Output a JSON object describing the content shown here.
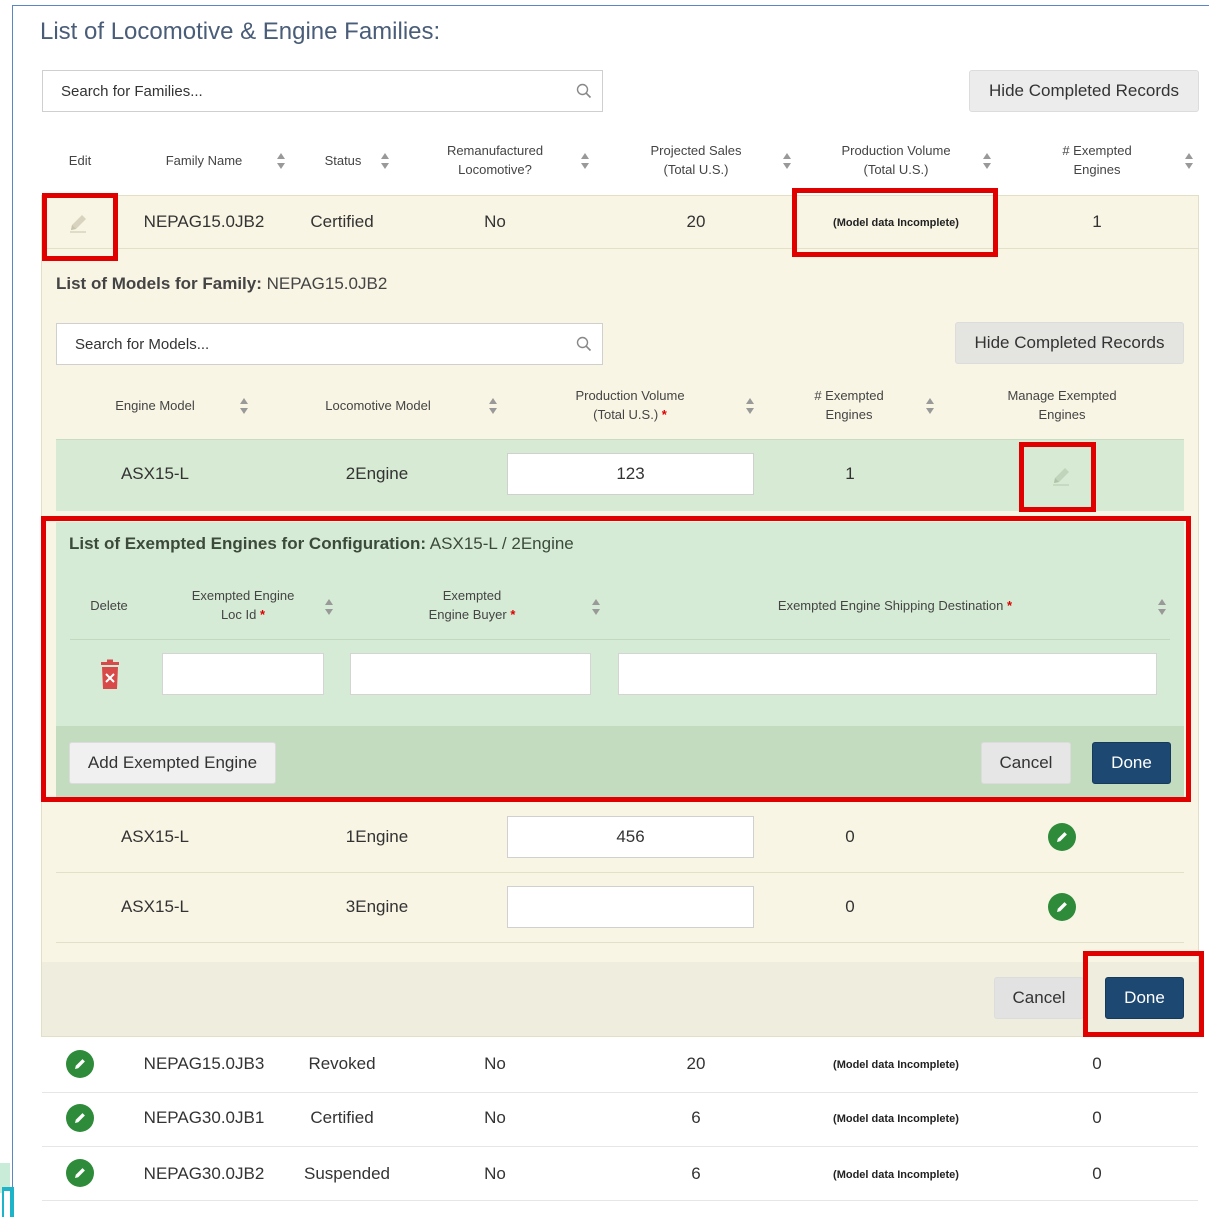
{
  "page": {
    "title": "List of Locomotive & Engine Families:"
  },
  "family_search": {
    "placeholder": "Search for Families..."
  },
  "family_hide_button": "Hide Completed Records",
  "family_table": {
    "headers": {
      "edit": "Edit",
      "family_name": "Family Name",
      "status": "Status",
      "reman_1": "Remanufactured",
      "reman_2": "Locomotive?",
      "sales_1": "Projected Sales",
      "sales_2": "(Total U.S.)",
      "prod_1": "Production Volume",
      "prod_2": "(Total U.S.)",
      "exempt_1": "# Exempted",
      "exempt_2": "Engines"
    },
    "expanded_row": {
      "family_name": "NEPAG15.0JB2",
      "status": "Certified",
      "remanufactured": "No",
      "projected_sales": "20",
      "production_volume": "(Model data Incomplete)",
      "exempted": "1"
    },
    "other_rows": [
      {
        "family_name": "NEPAG15.0JB3",
        "status": "Revoked",
        "remanufactured": "No",
        "projected_sales": "20",
        "production_volume": "(Model data Incomplete)",
        "exempted": "0"
      },
      {
        "family_name": "NEPAG30.0JB1",
        "status": "Certified",
        "remanufactured": "No",
        "projected_sales": "6",
        "production_volume": "(Model data Incomplete)",
        "exempted": "0"
      },
      {
        "family_name": "NEPAG30.0JB2",
        "status": "Suspended",
        "remanufactured": "No",
        "projected_sales": "6",
        "production_volume": "(Model data Incomplete)",
        "exempted": "0"
      }
    ]
  },
  "models": {
    "title_label": "List of Models for Family:",
    "title_value": "NEPAG15.0JB2",
    "search_placeholder": "Search for Models...",
    "hide_button": "Hide Completed Records",
    "headers": {
      "engine_model": "Engine Model",
      "loco_model": "Locomotive Model",
      "prod_1": "Production Volume",
      "prod_2": "(Total U.S.)",
      "exempt_1": "# Exempted",
      "exempt_2": "Engines",
      "manage_1": "Manage Exempted",
      "manage_2": "Engines"
    },
    "rows": [
      {
        "engine_model": "ASX15-L",
        "loco_model": "2Engine",
        "production": "123",
        "exempted": "1"
      },
      {
        "engine_model": "ASX15-L",
        "loco_model": "1Engine",
        "production": "456",
        "exempted": "0"
      },
      {
        "engine_model": "ASX15-L",
        "loco_model": "3Engine",
        "production": "",
        "exempted": "0"
      }
    ],
    "cancel_button": "Cancel",
    "done_button": "Done"
  },
  "exempted": {
    "title_label": "List of Exempted Engines for Configuration:",
    "title_value": "ASX15-L / 2Engine",
    "headers": {
      "delete": "Delete",
      "loc_1": "Exempted Engine",
      "loc_2": "Loc Id",
      "buyer_1": "Exempted",
      "buyer_2": "Engine Buyer",
      "dest": "Exempted Engine Shipping Destination",
      "required": "*"
    },
    "add_button": "Add Exempted Engine",
    "cancel_button": "Cancel",
    "done_button": "Done"
  },
  "colors": {
    "title": "#4a5d78",
    "highlight": "#e00000",
    "primary_button": "#1d4872",
    "family_panel": "#f8f5e4",
    "config_panel": "#d6ebd5",
    "edit_icon_green": "#2e8b3a"
  },
  "icons": {
    "search": "search-icon",
    "sort": "sort-icon",
    "edit_disabled": "pencil-icon",
    "edit_active": "pencil-circle-icon",
    "delete": "trash-icon"
  }
}
